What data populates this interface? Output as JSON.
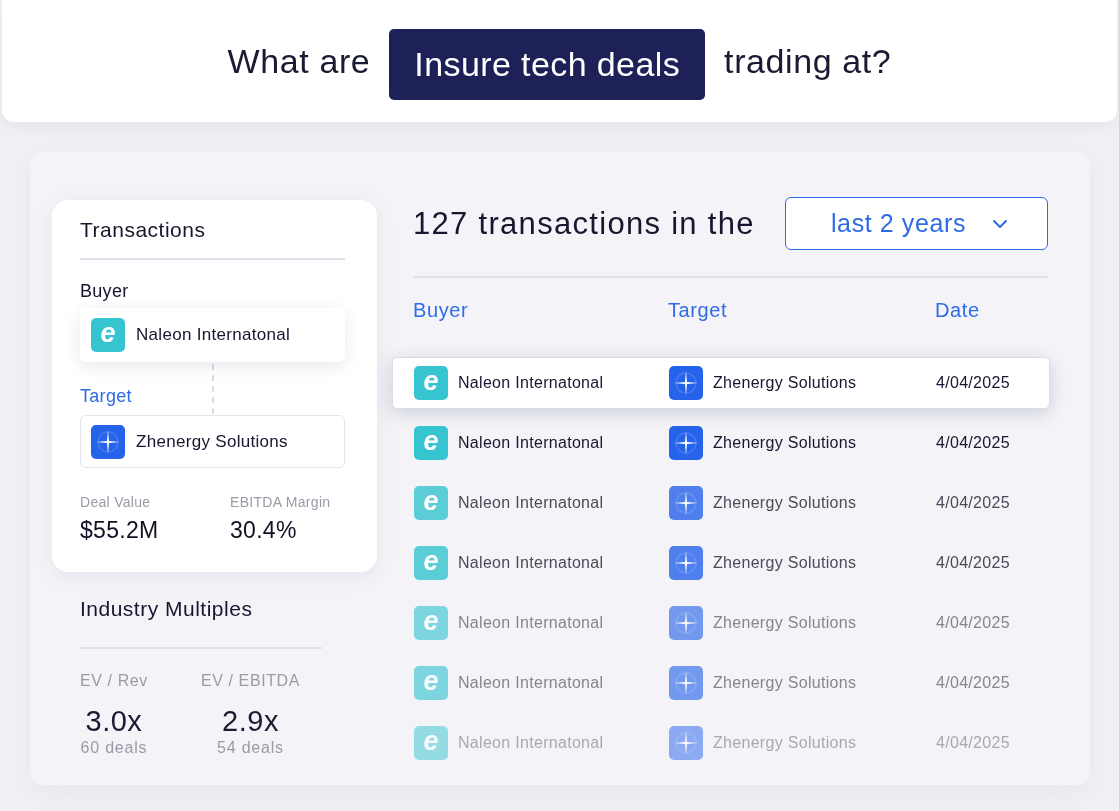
{
  "query": {
    "before": "What are",
    "highlight": "Insure tech deals",
    "after": "trading at?"
  },
  "transaction_card": {
    "title": "Transactions",
    "parties": [
      {
        "label": "Buyer",
        "selected": false,
        "company": {
          "logo": {
            "kind": "letter",
            "text": "e"
          },
          "name": "Naleon Internatonal"
        }
      },
      {
        "label": "Target",
        "selected": true,
        "company": {
          "logo": {
            "kind": "cross"
          },
          "name": "Zhenergy Solutions"
        }
      }
    ],
    "metrics": [
      {
        "label": "Deal Value",
        "value": "$55.2M"
      },
      {
        "label": "EBITDA Margin",
        "value": "30.4%"
      }
    ]
  },
  "industry_multiples": {
    "title": "Industry Multiples",
    "items": [
      {
        "label": "EV / Rev",
        "value": "3.0x",
        "count": "60 deals"
      },
      {
        "label": "EV / EBITDA",
        "value": "2.9x",
        "count": "54 deals"
      }
    ]
  },
  "results": {
    "heading": "127 transactions in the",
    "period_dropdown": {
      "value": "last 2 years"
    },
    "columns": [
      "Buyer",
      "Target",
      "Date"
    ],
    "rows": [
      {
        "selected": true,
        "buyer": {
          "logo": {
            "kind": "letter",
            "text": "e"
          },
          "name": "Naleon Internatonal"
        },
        "target": {
          "logo": {
            "kind": "cross"
          },
          "name": "Zhenergy Solutions"
        },
        "date": "4/04/2025"
      },
      {
        "selected": false,
        "buyer": {
          "logo": {
            "kind": "letter",
            "text": "e"
          },
          "name": "Naleon Internatonal"
        },
        "target": {
          "logo": {
            "kind": "cross"
          },
          "name": "Zhenergy Solutions"
        },
        "date": "4/04/2025"
      },
      {
        "selected": false,
        "buyer": {
          "logo": {
            "kind": "letter",
            "text": "e"
          },
          "name": "Naleon Internatonal"
        },
        "target": {
          "logo": {
            "kind": "cross"
          },
          "name": "Zhenergy Solutions"
        },
        "date": "4/04/2025"
      },
      {
        "selected": false,
        "buyer": {
          "logo": {
            "kind": "letter",
            "text": "e"
          },
          "name": "Naleon Internatonal"
        },
        "target": {
          "logo": {
            "kind": "cross"
          },
          "name": "Zhenergy Solutions"
        },
        "date": "4/04/2025"
      },
      {
        "selected": false,
        "buyer": {
          "logo": {
            "kind": "letter",
            "text": "e"
          },
          "name": "Naleon Internatonal"
        },
        "target": {
          "logo": {
            "kind": "cross"
          },
          "name": "Zhenergy Solutions"
        },
        "date": "4/04/2025"
      },
      {
        "selected": false,
        "buyer": {
          "logo": {
            "kind": "letter",
            "text": "e"
          },
          "name": "Naleon Internatonal"
        },
        "target": {
          "logo": {
            "kind": "cross"
          },
          "name": "Zhenergy Solutions"
        },
        "date": "4/04/2025"
      },
      {
        "selected": false,
        "buyer": {
          "logo": {
            "kind": "letter",
            "text": "e"
          },
          "name": "Naleon Internatonal"
        },
        "target": {
          "logo": {
            "kind": "cross"
          },
          "name": "Zhenergy Solutions"
        },
        "date": "4/04/2025"
      }
    ]
  }
}
